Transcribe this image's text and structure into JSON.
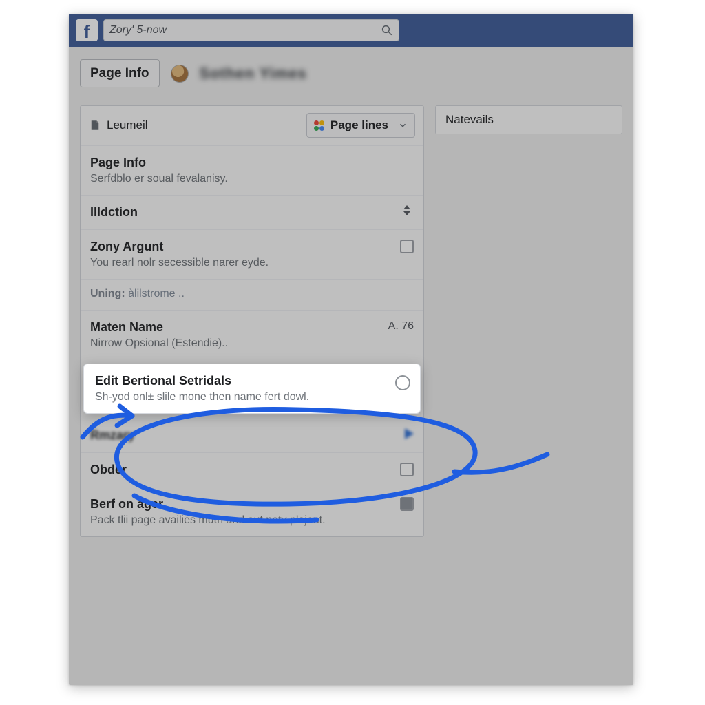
{
  "colors": {
    "brand": "#3b5998",
    "accent_scribble": "#1f5de0"
  },
  "topbar": {
    "search_value": "Zory' 5-now"
  },
  "header": {
    "page_info_button": "Page Info",
    "blurred_title": "Sothen Yimes"
  },
  "left_panel": {
    "header_label": "Leumeil",
    "page_lines_button": "Page lines",
    "sections": [
      {
        "title": "Page Info",
        "subtitle": "Serfdblo er soual fevalanisy."
      },
      {
        "title": "Illdction"
      },
      {
        "title": "Zony Argunt",
        "subtitle": "You rearl nolr secessible narer eyde."
      }
    ],
    "uning_label": "Uning:",
    "uning_value": "àlilstrome ..",
    "maten": {
      "title": "Maten Name",
      "subtitle": "Nirrow Opsional (Estendie)..",
      "badge": "A. 76"
    },
    "highlight": {
      "title": "Edit Bertional Setridals",
      "subtitle": "Sh-yod onl± slile mone then name fert dowl."
    },
    "rmrry": {
      "title": "Rmzary"
    },
    "obder": {
      "title": "Obder"
    },
    "berf": {
      "title": "Berf on ager",
      "subtitle": "Pack tlii page availies muth and out notv plajent."
    }
  },
  "right_panel": {
    "natevails_label": "Natevails"
  }
}
